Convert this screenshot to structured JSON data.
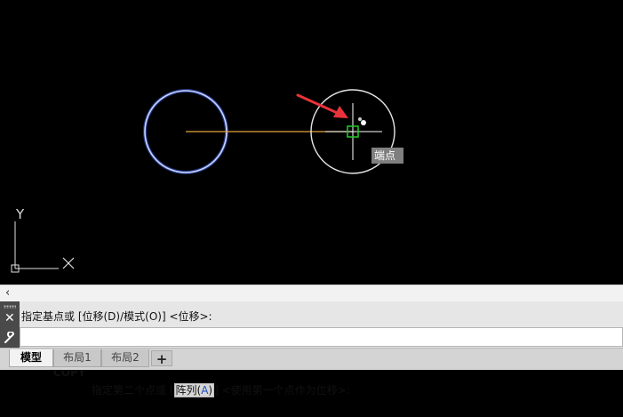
{
  "drawing": {
    "snap_tooltip": "端点",
    "ucs": {
      "x_label": "X",
      "y_label": "Y"
    }
  },
  "command_history": {
    "collapse_glyph": "‹",
    "last_line": "指定基点或 [位移(D)/模式(O)] <位移>:"
  },
  "command_line": {
    "close_glyph": "✕",
    "customize_glyph": "🔧",
    "command": "COPY",
    "prompt_before": "指定第二个点或 [",
    "option_label": "阵列(",
    "option_key": "A",
    "option_close": ")",
    "prompt_after": "] <使用第一个点作为位移>:"
  },
  "layout_tabs": {
    "tabs": [
      "模型",
      "布局1",
      "布局2"
    ],
    "add_label": "+"
  },
  "colors": {
    "selected_circle": "#8fa8ff",
    "ghost_circle": "#e0e0e0",
    "rubber_band": "#f0a540",
    "snap_marker": "#22c22e",
    "arrow": "#e8333a"
  },
  "icons": [
    "snap-endpoint-marker-icon",
    "red-arrow-icon",
    "close-icon",
    "wrench-icon",
    "command-icon",
    "ucs-icon"
  ]
}
